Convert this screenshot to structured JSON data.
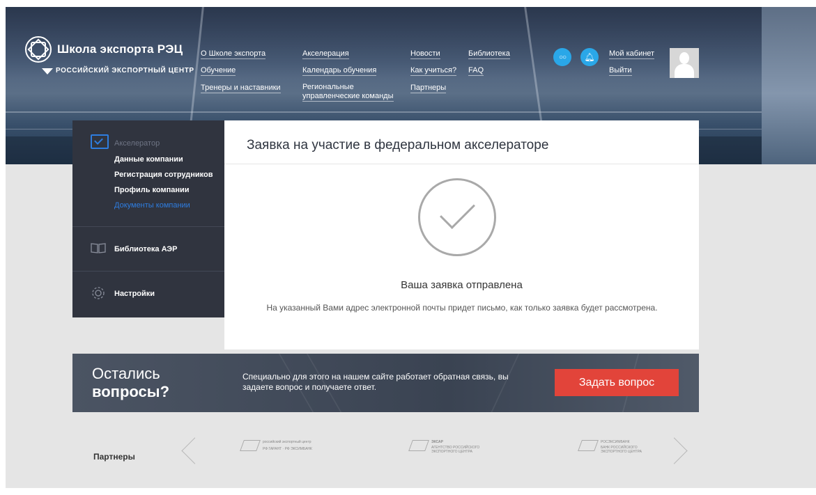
{
  "header": {
    "logo_title": "Школа экспорта РЭЦ",
    "logo_subtitle": "РОССИЙСКИЙ ЭКСПОРТНЫЙ ЦЕНТР",
    "nav": {
      "about": "О Школе экспорта",
      "acceleration": "Акселерация",
      "news": "Новости",
      "library": "Библиотека",
      "training": "Обучение",
      "calendar": "Календарь обучения",
      "how_to_study": "Как учиться?",
      "faq": "FAQ",
      "trainers": "Тренеры и наставники",
      "regional_teams_1": "Региональные",
      "regional_teams_2": "управленческие команды",
      "partners": "Партнеры"
    },
    "account": "Мой кабинет",
    "logout": "Выйти"
  },
  "sidebar": {
    "accelerator": {
      "title": "Акселератор",
      "items": [
        "Данные компании",
        "Регистрация сотрудников",
        "Профиль компании",
        "Документы компании"
      ]
    },
    "library": "Библиотека АЭР",
    "settings": "Настройки"
  },
  "main": {
    "title": "Заявка на участие в федеральном акселераторе",
    "status_title": "Ваша заявка отправлена",
    "status_text": "На указанный Вами адрес электронной почты придет письмо, как только заявка будет рассмотрена."
  },
  "questions": {
    "line1": "Остались",
    "line2": "вопросы?",
    "text": "Специально для этого на нашем сайте работает обратная связь, вы задаете вопрос и получаете ответ.",
    "button": "Задать вопрос"
  },
  "partners": {
    "label": "Партнеры",
    "logos": [
      {
        "name": "российский экспортный центр",
        "sub": "РФ ГАРАНТ · РФ ЭКСИМБАНК"
      },
      {
        "name": "ЭКСАР",
        "sub": "АГЕНТСТВО РОССИЙСКОГО ЭКСПОРТНОГО ЦЕНТРА"
      },
      {
        "name": "РОСЭКСИМБАНК",
        "sub": "БАНК РОССИЙСКОГО ЭКСПОРТНОГО ЦЕНТРА"
      }
    ]
  },
  "colors": {
    "accent_blue": "#2e7de0",
    "cta_red": "#e2443a",
    "sidebar_bg": "#30343f",
    "icon_blue": "#2aa7e8"
  }
}
